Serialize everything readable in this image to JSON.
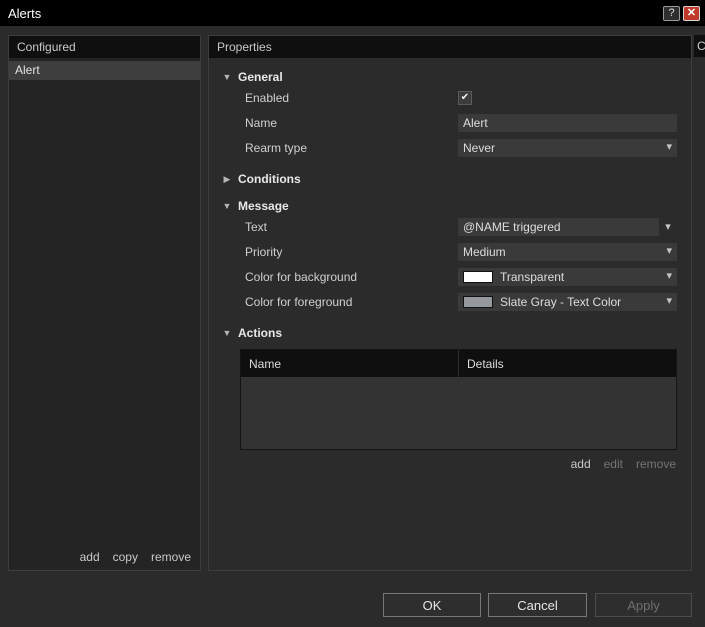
{
  "window": {
    "title": "Alerts",
    "help_label": "?",
    "close_label": "✕"
  },
  "icons": {
    "check": "✔",
    "chevron_down": "▾",
    "section_expanded": "▼",
    "section_collapsed": "▶"
  },
  "configured_panel": {
    "header": "Configured",
    "items": [
      {
        "label": "Alert"
      }
    ],
    "links": {
      "add": "add",
      "copy": "copy",
      "remove": "remove"
    }
  },
  "properties_panel": {
    "header": "Properties",
    "general": {
      "label": "General",
      "enabled_label": "Enabled",
      "enabled_checked": true,
      "name_label": "Name",
      "name_value": "Alert",
      "rearm_label": "Rearm type",
      "rearm_value": "Never"
    },
    "conditions": {
      "label": "Conditions"
    },
    "message": {
      "label": "Message",
      "text_label": "Text",
      "text_value": "@NAME triggered",
      "priority_label": "Priority",
      "priority_value": "Medium",
      "background_label": "Color for background",
      "background_value": "Transparent",
      "background_swatch": "#ffffff",
      "foreground_label": "Color for foreground",
      "foreground_value": "Slate Gray - Text Color",
      "foreground_swatch": "#95999d"
    },
    "actions": {
      "label": "Actions",
      "table": {
        "columns": [
          "Name",
          "Details"
        ],
        "rows": []
      },
      "links": {
        "add": "add",
        "edit": "edit",
        "remove": "remove"
      }
    }
  },
  "footer": {
    "ok": "OK",
    "cancel": "Cancel",
    "apply": "Apply"
  },
  "background_window": {
    "partial_text": "C"
  }
}
